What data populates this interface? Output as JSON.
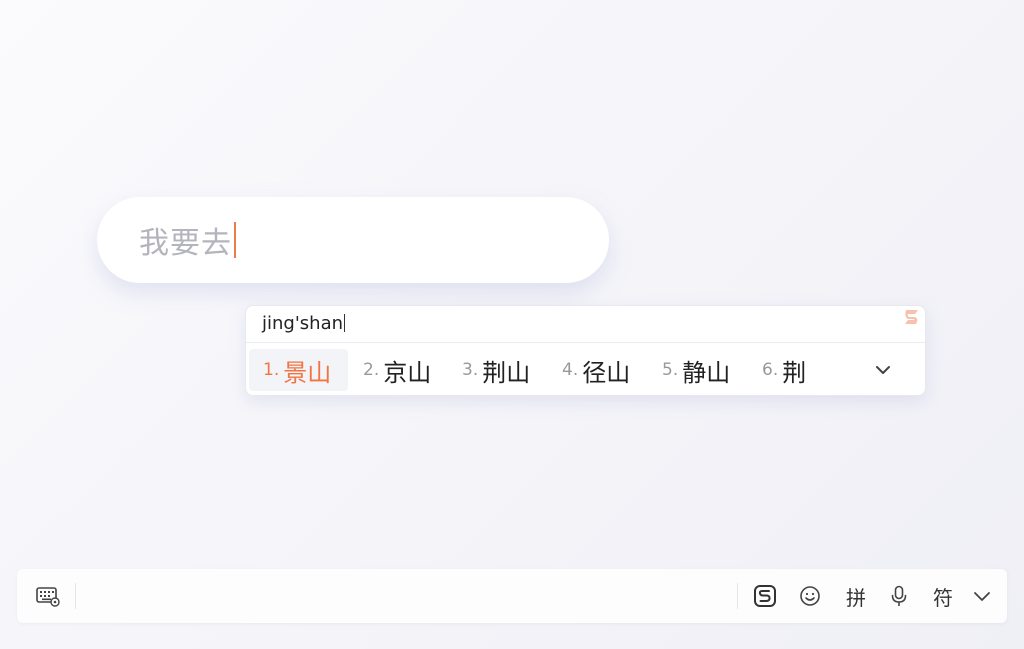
{
  "input": {
    "text": "我要去"
  },
  "candidate_panel": {
    "composition": "jing'shan",
    "candidates": [
      {
        "num": "1.",
        "word": "景山"
      },
      {
        "num": "2.",
        "word": "京山"
      },
      {
        "num": "3.",
        "word": "荆山"
      },
      {
        "num": "4.",
        "word": "径山"
      },
      {
        "num": "5.",
        "word": "静山"
      },
      {
        "num": "6.",
        "word": "荆"
      }
    ],
    "expand_icon": "chevron-down-icon",
    "brand_icon": "sogou-logo-icon"
  },
  "toolbar": {
    "keyboard_icon": "keyboard-settings-icon",
    "sogou_icon": "sogou-logo-icon",
    "emoji_icon": "smiley-icon",
    "pinyin_label": "拼",
    "mic_icon": "microphone-icon",
    "symbol_label": "符",
    "collapse_icon": "chevron-down-icon"
  },
  "colors": {
    "accent": "#f27443",
    "caret": "#f07a48",
    "placeholder_text": "#b4b4bc"
  }
}
